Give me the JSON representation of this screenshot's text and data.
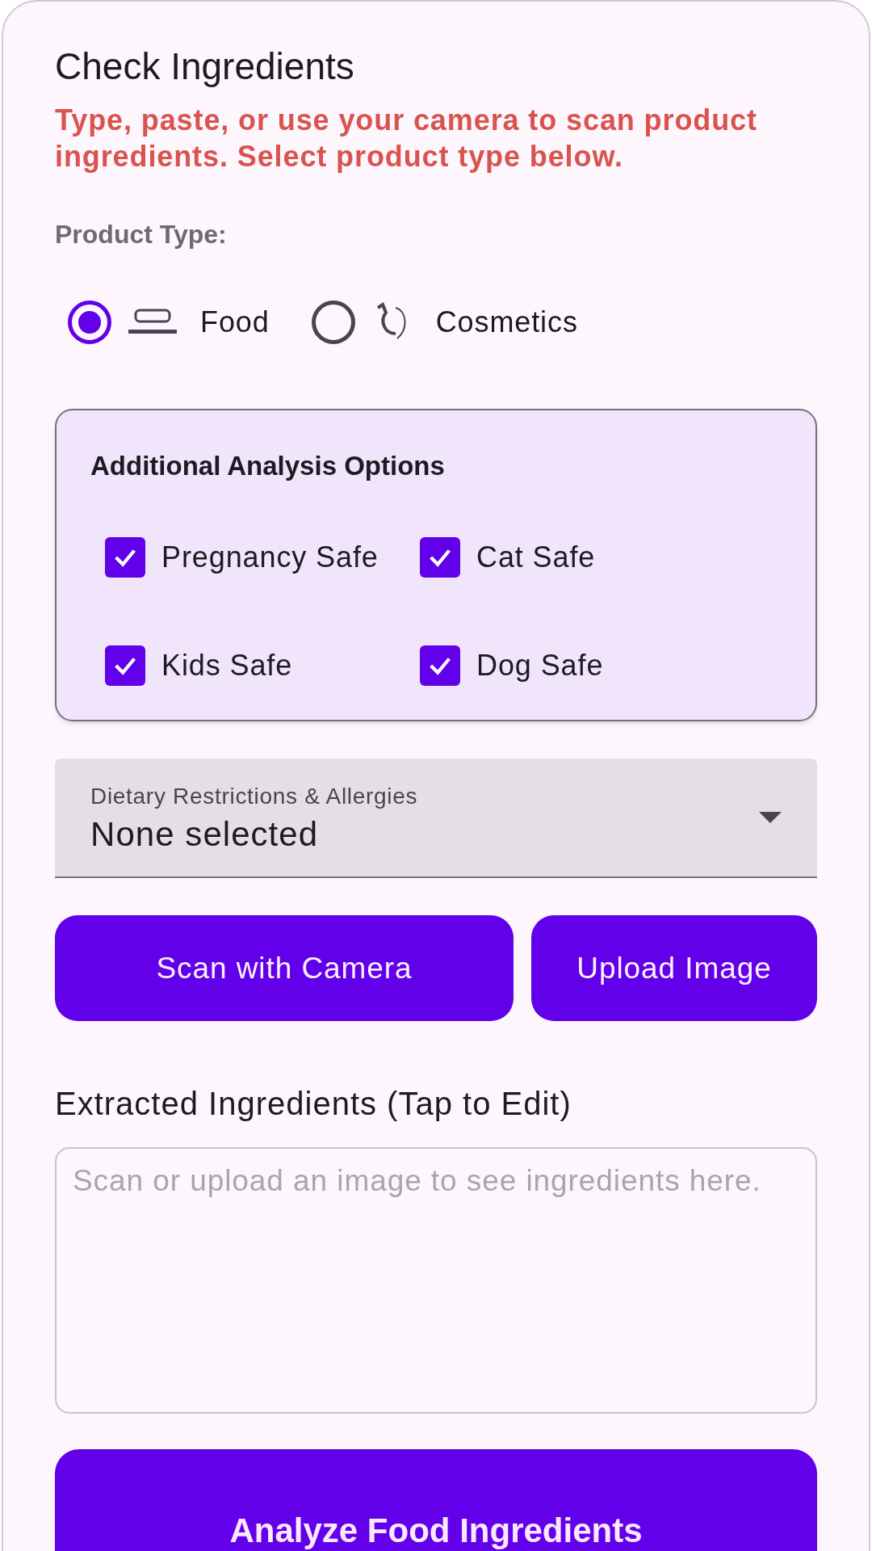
{
  "title": "Check Ingredients",
  "subtitle": "Type, paste, or use your camera to scan product ingredients. Select product type below.",
  "product_type": {
    "label": "Product Type:",
    "options": [
      {
        "label": "Food",
        "kind": "food",
        "selected": true
      },
      {
        "label": "Cosmetics",
        "kind": "cosmetics",
        "selected": false
      }
    ]
  },
  "analysis_options": {
    "title": "Additional Analysis Options",
    "items": [
      {
        "label": "Pregnancy Safe",
        "checked": true
      },
      {
        "label": "Cat Safe",
        "checked": true
      },
      {
        "label": "Kids Safe",
        "checked": true
      },
      {
        "label": "Dog Safe",
        "checked": true
      }
    ]
  },
  "dietary": {
    "label": "Dietary Restrictions & Allergies",
    "value": "None selected"
  },
  "buttons": [
    "Scan with Camera",
    "Upload Image"
  ],
  "ingredients": {
    "label": "Extracted Ingredients (Tap to Edit)",
    "placeholder": "Scan or upload an image to see ingredients here."
  },
  "analyze_button": "Analyze Food Ingredients"
}
